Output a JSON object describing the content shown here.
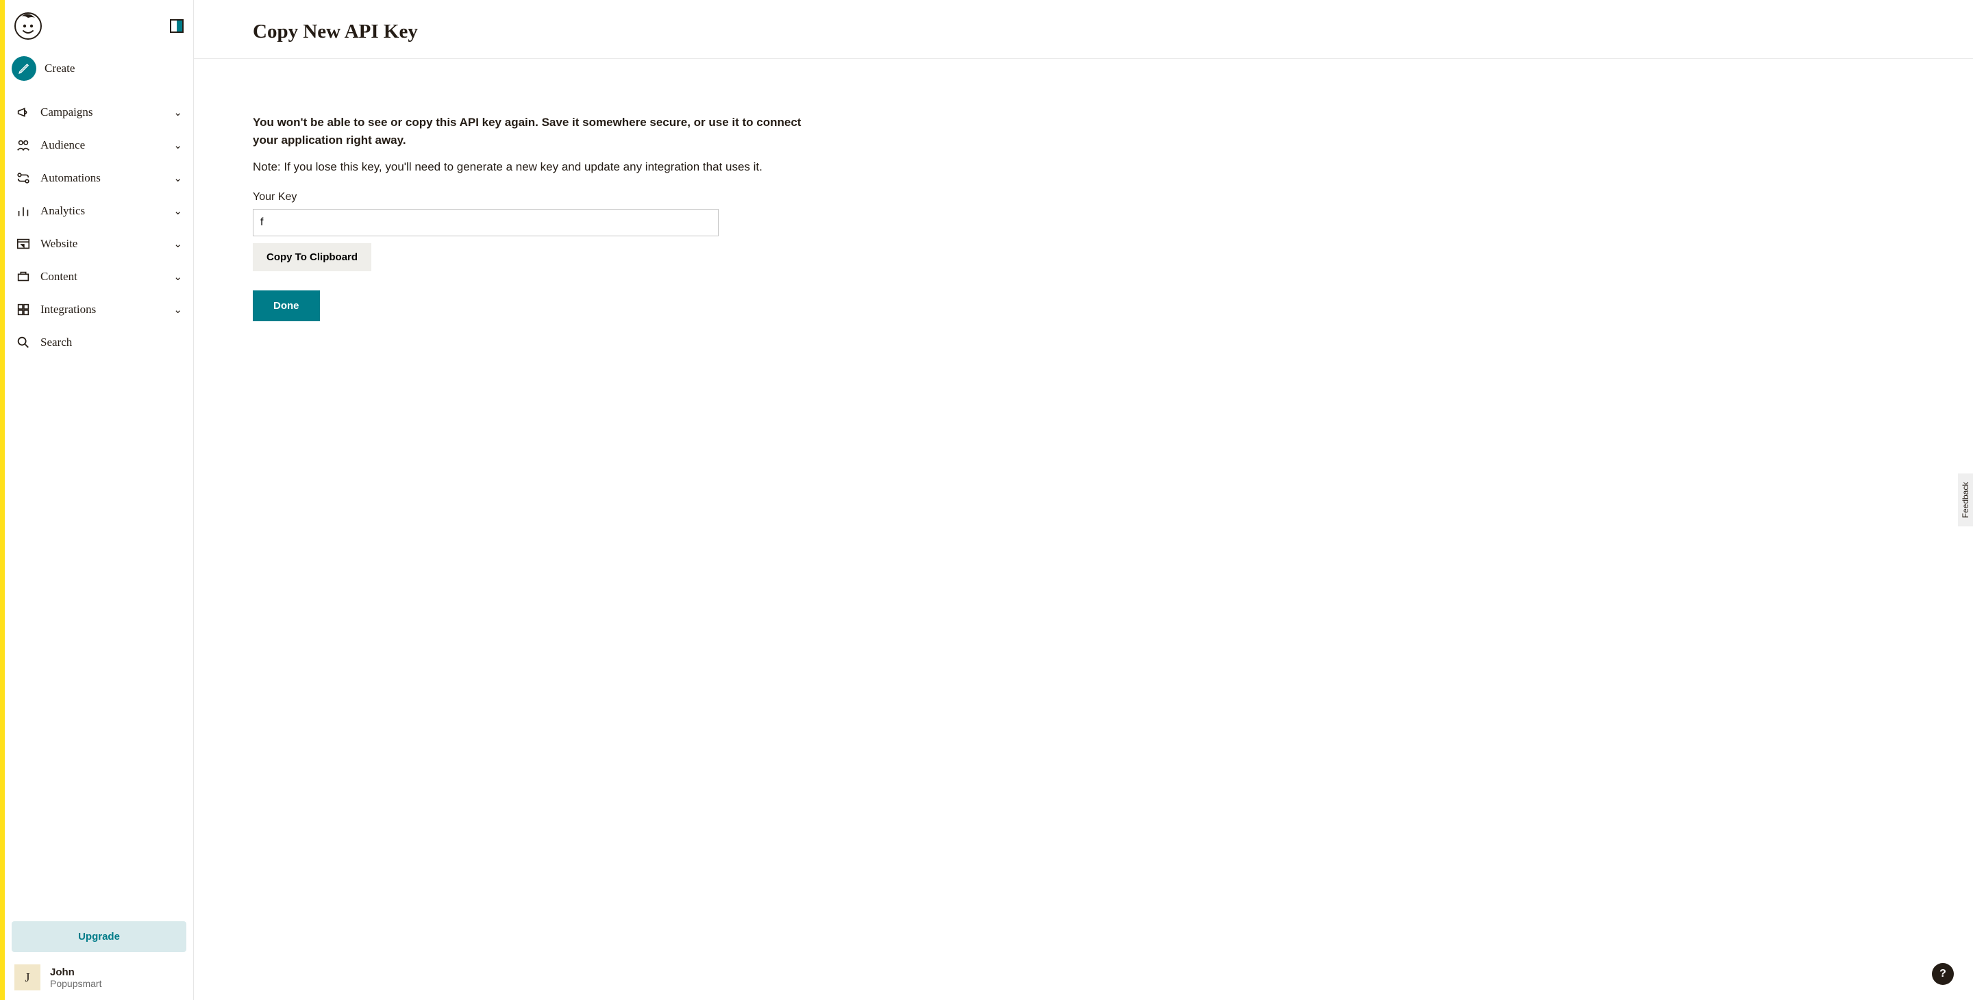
{
  "sidebar": {
    "create_label": "Create",
    "items": [
      {
        "label": "Campaigns",
        "expandable": true
      },
      {
        "label": "Audience",
        "expandable": true
      },
      {
        "label": "Automations",
        "expandable": true
      },
      {
        "label": "Analytics",
        "expandable": true
      },
      {
        "label": "Website",
        "expandable": true
      },
      {
        "label": "Content",
        "expandable": true
      },
      {
        "label": "Integrations",
        "expandable": true
      },
      {
        "label": "Search",
        "expandable": false
      }
    ],
    "upgrade_label": "Upgrade",
    "user": {
      "name": "John",
      "org": "Popupsmart",
      "avatar_initial": "J"
    }
  },
  "page": {
    "title": "Copy New API Key",
    "warning": "You won't be able to see or copy this API key again. Save it somewhere secure, or use it to connect your application right away.",
    "note": "Note: If you lose this key, you'll need to generate a new key and update any integration that uses it.",
    "key_label": "Your Key",
    "key_value": "f",
    "copy_label": "Copy To Clipboard",
    "done_label": "Done"
  },
  "rail": {
    "feedback_label": "Feedback",
    "help_label": "?"
  }
}
